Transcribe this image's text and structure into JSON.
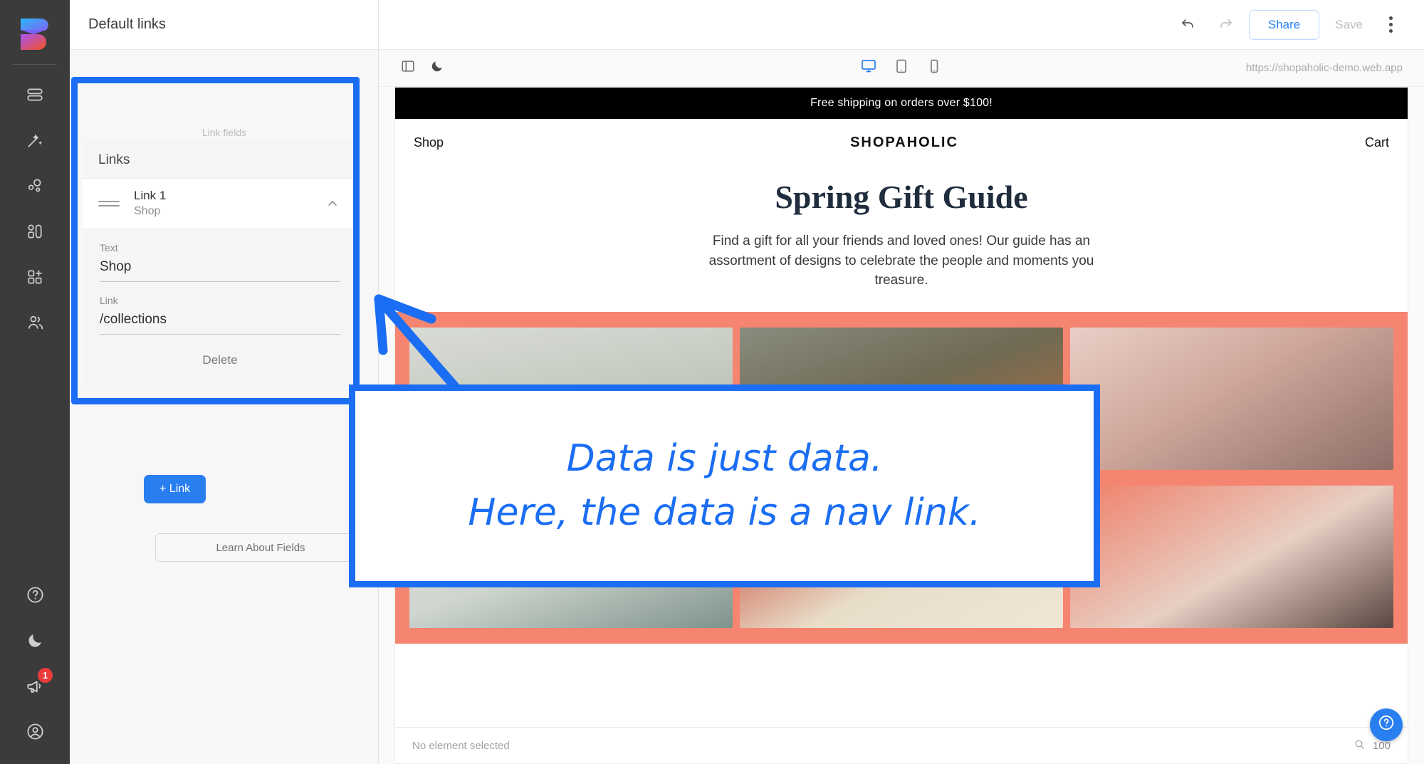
{
  "app": {
    "logo_icon": "bravo-b-logo",
    "rail_items": [
      {
        "name": "layers-icon"
      },
      {
        "name": "magic-wand-icon"
      },
      {
        "name": "nodes-icon"
      },
      {
        "name": "components-icon"
      },
      {
        "name": "add-component-icon"
      },
      {
        "name": "people-icon"
      }
    ],
    "rail_bottom": [
      {
        "name": "help-circle-icon"
      },
      {
        "name": "moon-icon"
      },
      {
        "name": "megaphone-icon",
        "badge": "1"
      },
      {
        "name": "account-icon"
      }
    ]
  },
  "inspector": {
    "title": "Default links",
    "obscured_label": "Link fields",
    "links_section_label": "Links",
    "link_row": {
      "title": "Link 1",
      "subtitle": "Shop",
      "drag_handle_icon": "drag-handle-icon",
      "collapse_icon": "chevron-up-icon"
    },
    "fields": [
      {
        "label": "Text",
        "value": "Shop"
      },
      {
        "label": "Link",
        "value": "/collections"
      }
    ],
    "delete_label": "Delete",
    "add_link_label": "+ Link",
    "learn_label": "Learn About Fields"
  },
  "toolbar": {
    "undo_icon": "undo-arrow-icon",
    "redo_icon": "redo-arrow-icon",
    "share_label": "Share",
    "save_label": "Save",
    "kebab_icon": "more-vertical-icon"
  },
  "preview_bar": {
    "panel_toggle_icon": "panel-toggle-icon",
    "dark_mode_icon": "moon-icon",
    "devices": [
      {
        "name": "desktop-icon",
        "active": true
      },
      {
        "name": "tablet-icon",
        "active": false
      },
      {
        "name": "mobile-icon",
        "active": false
      }
    ],
    "url": "https://shopaholic-demo.web.app"
  },
  "site": {
    "promo_banner": "Free shipping on orders over $100!",
    "nav_left": "Shop",
    "brand": "SHOPAHOLIC",
    "nav_right": "Cart",
    "hero_title": "Spring Gift Guide",
    "hero_body": "Find a gift for all your friends and loved ones! Our guide has an assortment of designs to celebrate the people and moments you treasure.",
    "strip_bg": "#F58570"
  },
  "status": {
    "selection": "No element selected",
    "zoom_icon": "magnifier-icon",
    "zoom_value": "100",
    "help_fab_icon": "question-mark-icon"
  },
  "annotation": {
    "accent": "#1B6EF3",
    "line1": "Data is just data.",
    "line2": "Here, the data is a nav link."
  }
}
